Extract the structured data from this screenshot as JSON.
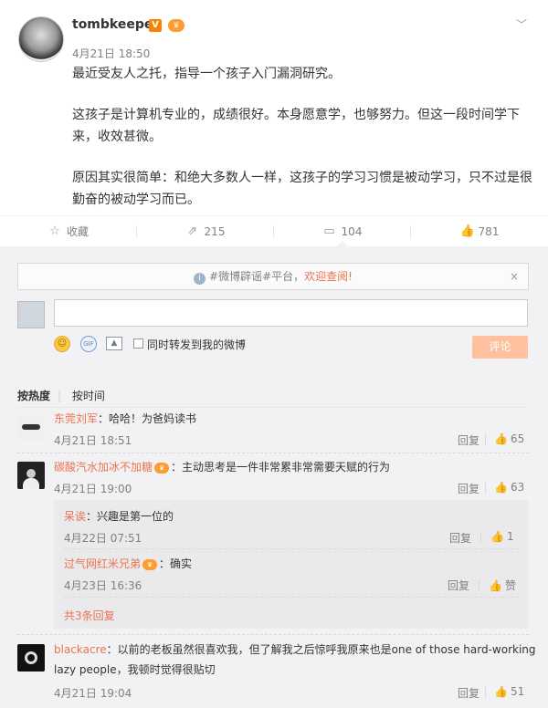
{
  "post": {
    "username": "tombkeeper",
    "verified_badge": "V",
    "time": "4月21日 18:50",
    "paragraphs": [
      "最近受友人之托，指导一个孩子入门漏洞研究。",
      "这孩子是计算机专业的，成绩很好。本身愿意学，也够努力。但这一段时间学下来，收效甚微。",
      "原因其实很简单：和绝大多数人一样，这孩子的学习习惯是被动学习，只不过是很勤奋的被动学习而已。"
    ]
  },
  "actions": {
    "favorite": "收藏",
    "forward": "215",
    "comment": "104",
    "like": "781"
  },
  "notice": {
    "prefix": "#微博辟谣#平台，",
    "link": "欢迎查阅!",
    "close": "×"
  },
  "composer": {
    "input_value": "",
    "repost_label": "同时转发到我的微博",
    "submit_label": "评论"
  },
  "sort_tabs": {
    "hot": "按热度",
    "time": "按时间"
  },
  "comments": [
    {
      "user": "东莞刘军",
      "text": "：哈哈！为爸妈读书",
      "time": "4月21日 18:51",
      "reply": "回复",
      "likes": "65"
    },
    {
      "user": "碳酸汽水加冰不加糖",
      "text": "：主动思考是一件非常累非常需要天赋的行为",
      "time": "4月21日 19:00",
      "reply": "回复",
      "likes": "63",
      "replies": [
        {
          "user": "呆诶",
          "text": "：兴趣是第一位的",
          "time": "4月22日 07:51",
          "reply": "回复",
          "likes": "1"
        },
        {
          "user": "过气网红米兄弟",
          "text": "：确实",
          "time": "4月23日 16:36",
          "reply": "回复",
          "likes": "赞"
        }
      ],
      "more": "共3条回复"
    },
    {
      "user": "blackacre",
      "text_line1": "：以前的老板虽然很喜欢我，但了解我之后惊呼我原来也是one of those hard-working",
      "text_line2": "lazy people，我顿时觉得很贴切",
      "time": "4月21日 19:04",
      "reply": "回复",
      "likes": "51"
    }
  ],
  "icons": {
    "favorite": "star-icon",
    "forward": "share-icon",
    "comment": "comment-icon",
    "like": "thumbs-up-icon"
  },
  "colors": {
    "accent": "#eb7350",
    "verified": "#f78400",
    "submit_disabled": "#ffc09f",
    "background": "#f2f2f5"
  }
}
